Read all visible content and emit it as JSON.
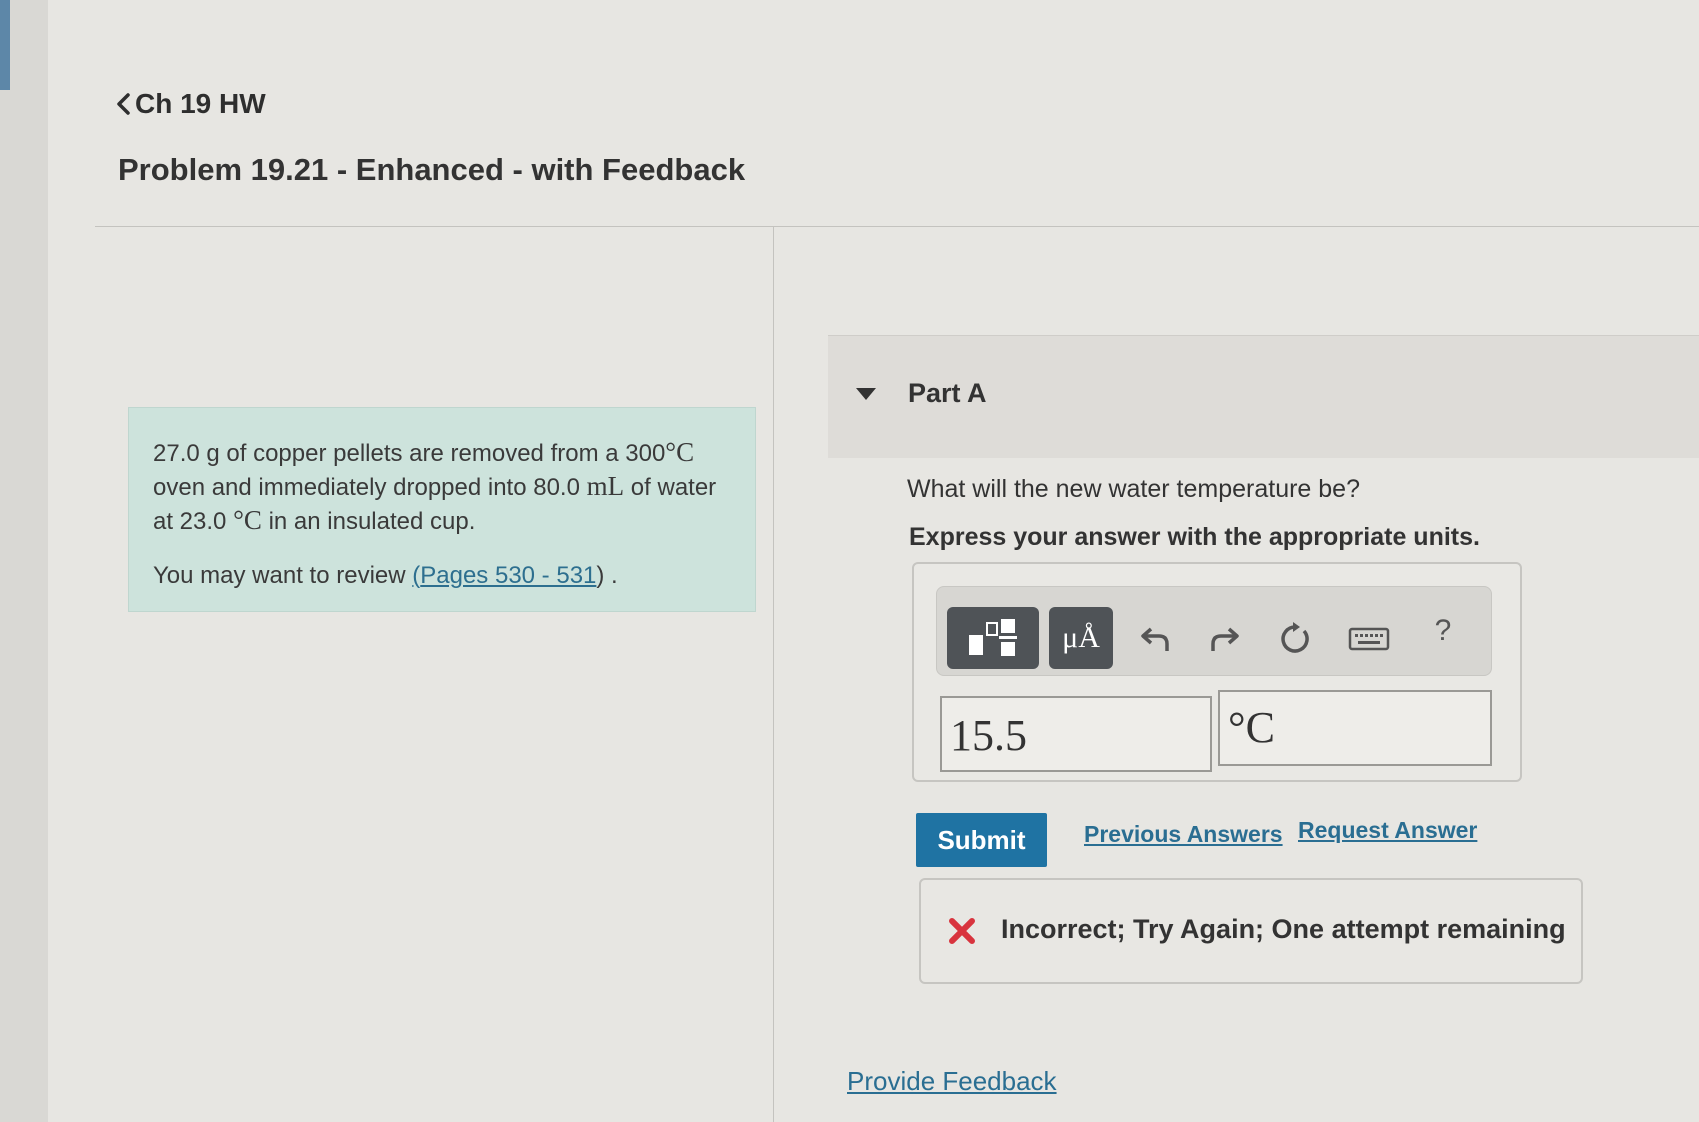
{
  "nav": {
    "back_label": "Ch 19 HW"
  },
  "page": {
    "title": "Problem 19.21 - Enhanced - with Feedback"
  },
  "problem": {
    "text_1": "27.0 g of copper pellets are removed from a 300",
    "unit_1": "°C",
    "text_2": "oven and immediately dropped into 80.0",
    "unit_2": "mL",
    "text_3": "of water at 23.0",
    "unit_3": "°C",
    "text_4": "in an insulated cup.",
    "review_prefix": "You may want to review",
    "review_open": "(",
    "review_link": "Pages 530 - 531",
    "review_close": ") ."
  },
  "part": {
    "title": "Part A"
  },
  "question": {
    "prompt": "What will the new water temperature be?",
    "instruction": "Express your answer with the appropriate units."
  },
  "toolbar": {
    "templates_icon": "templates-icon",
    "units_label": "μÅ",
    "undo_icon": "undo-icon",
    "redo_icon": "redo-icon",
    "reset_icon": "reset-icon",
    "keyboard_icon": "keyboard-icon",
    "help_label": "?"
  },
  "answer": {
    "value": "15.5",
    "units": "°C"
  },
  "actions": {
    "submit_label": "Submit",
    "previous_answers": "Previous Answers",
    "request_answer": "Request Answer"
  },
  "feedback": {
    "message": "Incorrect; Try Again; One attempt remaining",
    "status_color": "#d8343e"
  },
  "footer": {
    "provide_feedback": "Provide Feedback"
  }
}
